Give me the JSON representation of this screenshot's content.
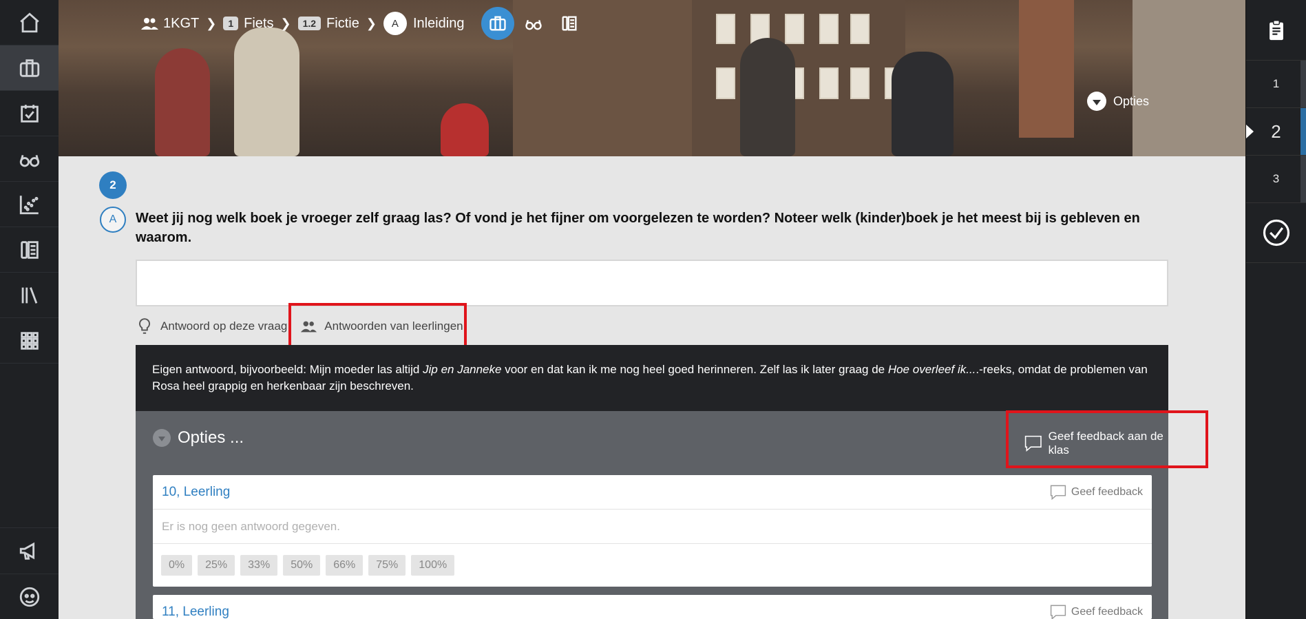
{
  "breadcrumb": {
    "class_label": "1KGT",
    "chapter_num": "1",
    "chapter_label": "Fiets",
    "section_num": "1.2",
    "section_label": "Fictie",
    "part_letter": "A",
    "part_label": "Inleiding"
  },
  "header": {
    "opties_label": "Opties"
  },
  "left_nav": [
    "home-icon",
    "briefcase-icon",
    "calendar-check-icon",
    "glasses-icon",
    "scatter-chart-icon",
    "book-pages-icon",
    "library-icon",
    "apps-grid-icon",
    "megaphone-icon",
    "avatar-icon"
  ],
  "right_nav": {
    "steps": [
      "1",
      "2",
      "3"
    ],
    "current_step": "2"
  },
  "question": {
    "step": "2",
    "letter": "A",
    "text": "Weet jij nog welk boek je vroeger zelf graag las? Of vond je het fijner om voorgelezen te worden? Noteer welk (kinder)boek je het meest bij is gebleven en waarom."
  },
  "tabs": {
    "answer_label": "Antwoord op deze vraag",
    "students_label": "Antwoorden van leerlingen"
  },
  "model_answer": {
    "part1": "Eigen antwoord, bijvoorbeeld: Mijn moeder las altijd ",
    "italic1": "Jip en Janneke",
    "part2": " voor en dat kan ik me nog heel goed herinneren. Zelf las ik later graag de ",
    "italic2": "Hoe overleef ik...",
    "part3": ".-reeks, omdat de problemen van Rosa heel grappig en herkenbaar zijn beschreven."
  },
  "options_panel": {
    "title": "Opties ...",
    "class_feedback_label": "Geef feedback aan de klas"
  },
  "students": [
    {
      "name": "10, Leerling",
      "feedback_label": "Geef feedback",
      "answer": "Er is nog geen antwoord gegeven.",
      "scores": [
        "0%",
        "25%",
        "33%",
        "50%",
        "66%",
        "75%",
        "100%"
      ]
    },
    {
      "name": "11, Leerling",
      "feedback_label": "Geef feedback"
    }
  ],
  "colors": {
    "accent_blue": "#2f7fc1",
    "highlight_red": "#e0141b",
    "sidebar_dark": "#1f2124"
  }
}
